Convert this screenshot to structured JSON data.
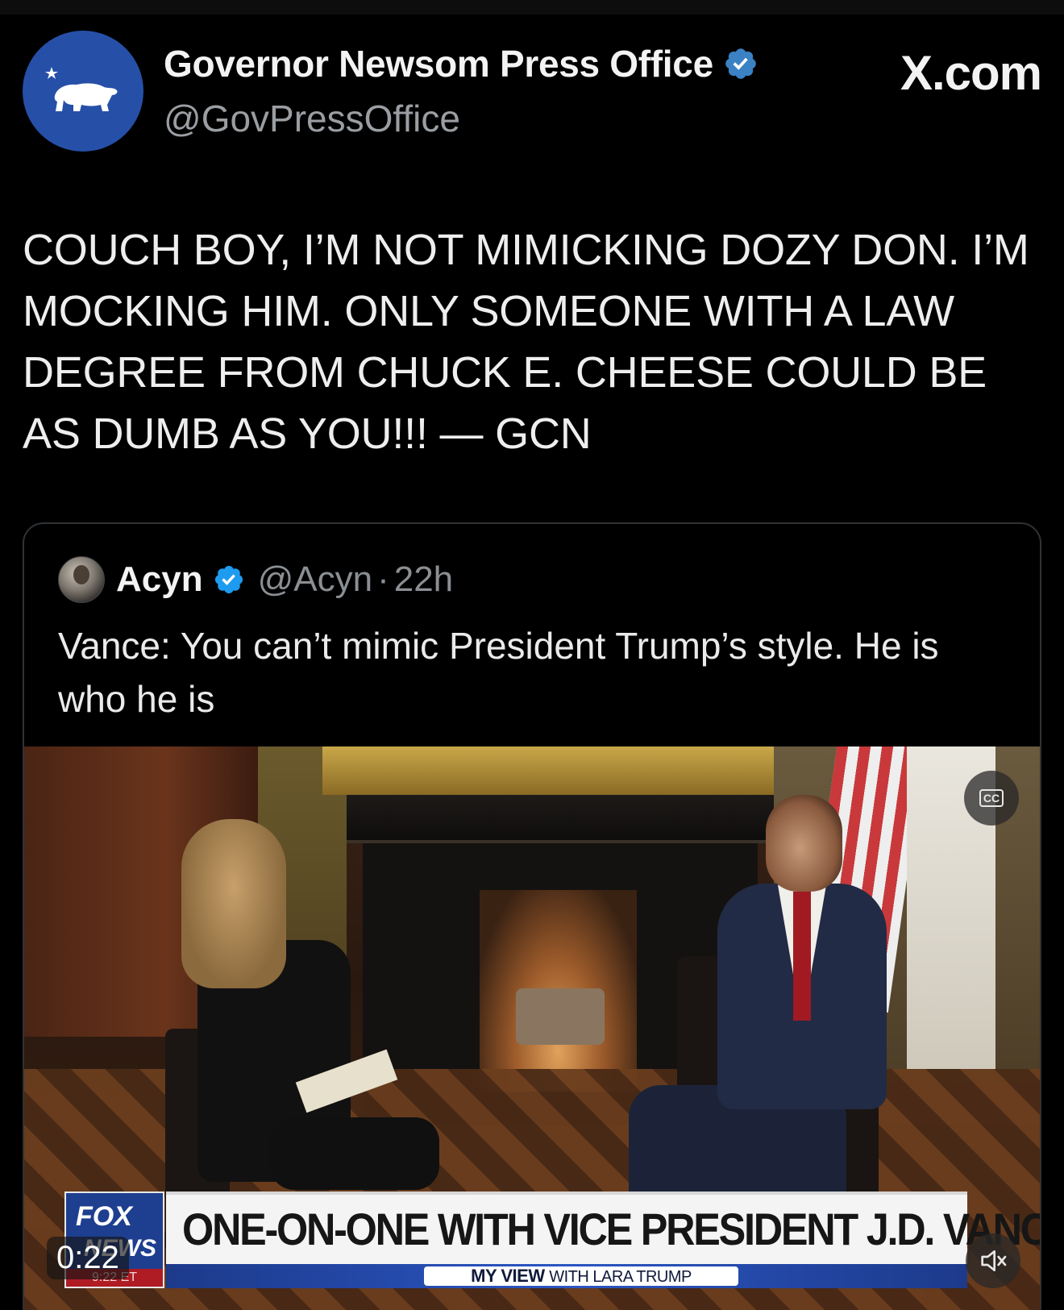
{
  "post": {
    "author": {
      "display_name": "Governor Newsom Press Office",
      "handle": "@GovPressOffice",
      "verified": true,
      "avatar_icon": "california-bear-icon",
      "avatar_color": "#2650a8"
    },
    "brand": "X.com",
    "text": "COUCH BOY, I’M NOT MIMICKING DOZY DON. I’M MOCKING HIM. ONLY SOMEONE WITH A LAW DEGREE FROM CHUCK E. CHEESE COULD BE AS DUMB AS YOU!!! — GCN"
  },
  "quote": {
    "author": {
      "display_name": "Acyn",
      "handle": "@Acyn",
      "time": "22h",
      "verified": true
    },
    "separator": "·",
    "text": "Vance: You can’t mimic President Trump’s style. He is who he is",
    "video": {
      "timestamp": "0:22",
      "cc_label": "CC",
      "lower_third": {
        "network_top": "FOX",
        "network_bottom": "NEWS",
        "clock": "9:22 ET",
        "headline": "ONE-ON-ONE WITH VICE PRESIDENT J.D. VANCE",
        "show": "MY VIEW",
        "host": "WITH LARA TRUMP"
      }
    }
  },
  "colors": {
    "background": "#000000",
    "text_primary": "#e7e9ea",
    "text_secondary": "#8b8f93",
    "verified_blue": "#1d9bf0",
    "card_border": "#2f3336"
  }
}
